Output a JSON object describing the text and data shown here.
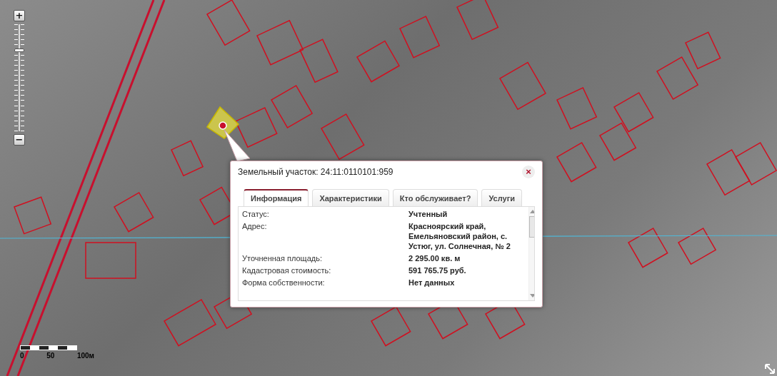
{
  "zoom_control": {
    "zoom_in": "+",
    "zoom_out": "−",
    "level": 0.74
  },
  "scale_bar": {
    "labels": [
      "0",
      "50",
      "100м"
    ]
  },
  "popup": {
    "title": "Земельный участок: 24:11:0110101:959",
    "close": "×",
    "tabs": [
      {
        "label": "Информация",
        "selected": true
      },
      {
        "label": "Характеристики",
        "selected": false
      },
      {
        "label": "Кто обслуживает?",
        "selected": false
      },
      {
        "label": "Услуги",
        "selected": false
      }
    ],
    "rows": [
      {
        "label": "Статус:",
        "value": "Учтенный"
      },
      {
        "label": "Адрес:",
        "value": "Красноярский край, Емельяновский район, с. Устюг, ул. Солнечная, № 2"
      },
      {
        "label": "Уточненная площадь:",
        "value": "2 295.00 кв. м"
      },
      {
        "label": "Кадастровая стоимость:",
        "value": "591 765.75 руб."
      },
      {
        "label": "Форма собственности:",
        "value": "Нет данных"
      }
    ]
  }
}
